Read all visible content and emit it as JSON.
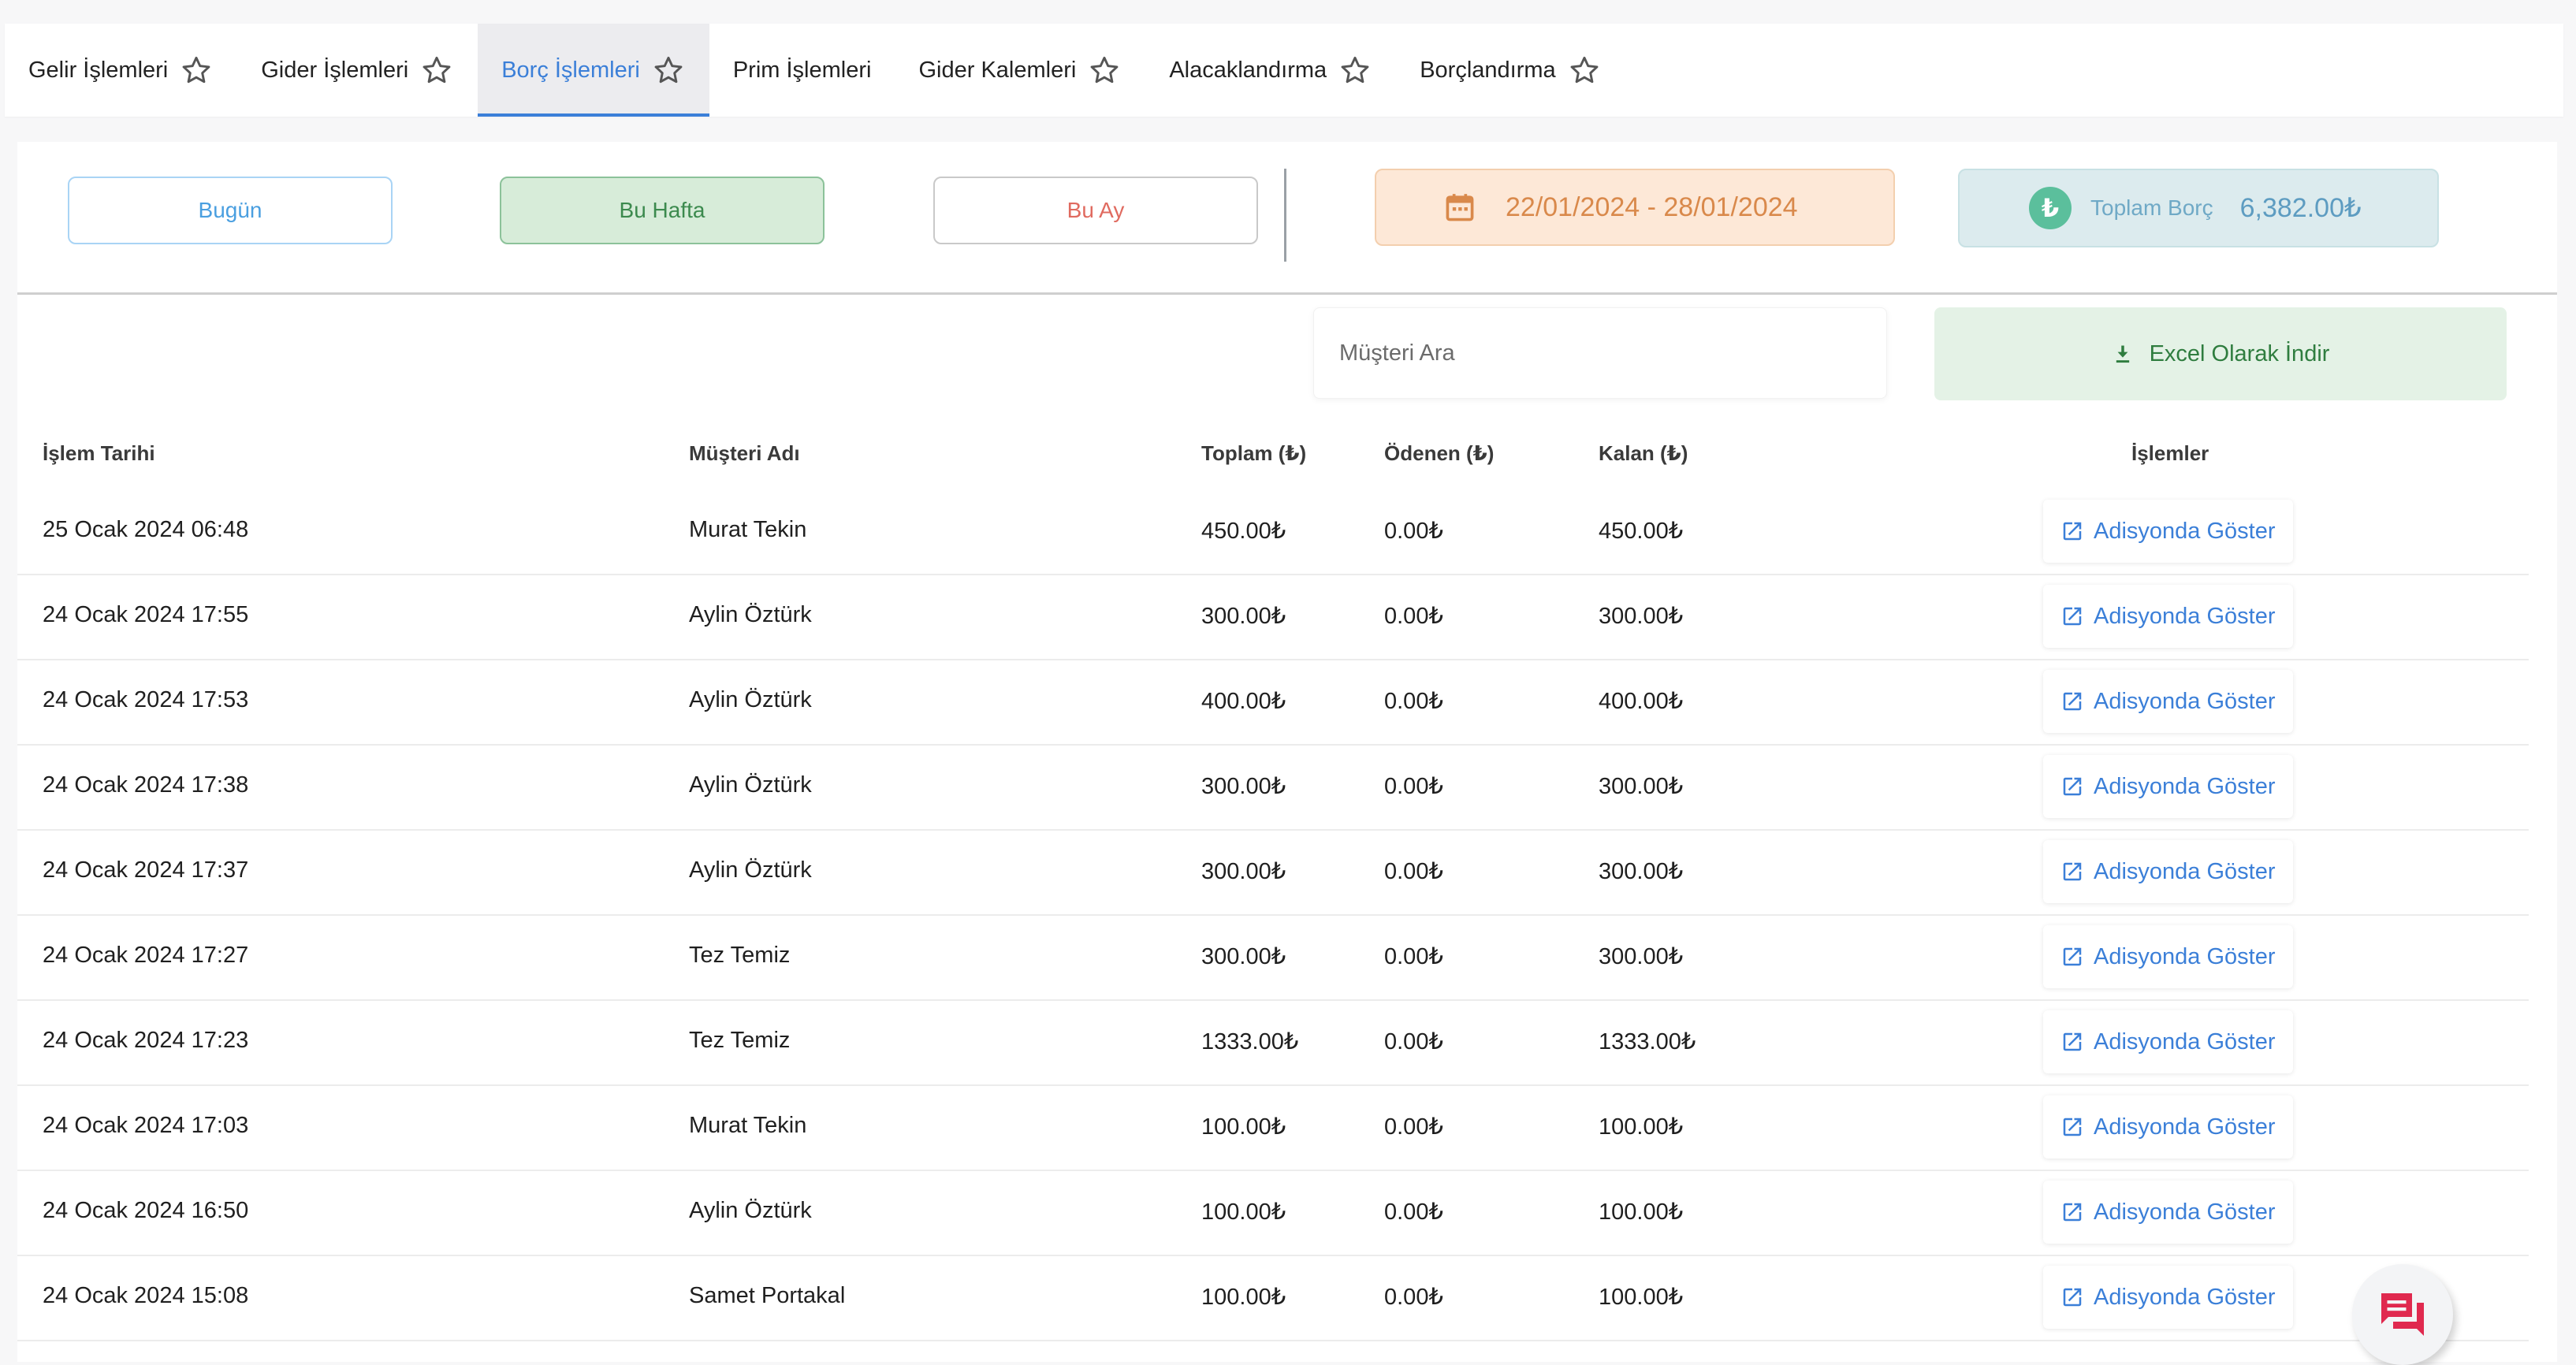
{
  "tabs": [
    {
      "label": "Gelir İşlemleri",
      "starred": true,
      "active": false
    },
    {
      "label": "Gider İşlemleri",
      "starred": true,
      "active": false
    },
    {
      "label": "Borç İşlemleri",
      "starred": true,
      "active": true
    },
    {
      "label": "Prim İşlemleri",
      "starred": false,
      "active": false
    },
    {
      "label": "Gider Kalemleri",
      "starred": true,
      "active": false
    },
    {
      "label": "Alacaklandırma",
      "starred": true,
      "active": false
    },
    {
      "label": "Borçlandırma",
      "starred": true,
      "active": false
    }
  ],
  "filters": {
    "today": "Bugün",
    "week": "Bu Hafta",
    "month": "Bu Ay"
  },
  "date_range": "22/01/2024 - 28/01/2024",
  "total": {
    "label": "Toplam Borç",
    "value": "6,382.00₺"
  },
  "search": {
    "placeholder": "Müşteri Ara",
    "value": ""
  },
  "excel_label": "Excel Olarak İndir",
  "table": {
    "headers": {
      "date": "İşlem Tarihi",
      "customer": "Müşteri Adı",
      "total": "Toplam (₺)",
      "paid": "Ödenen (₺)",
      "remaining": "Kalan (₺)",
      "actions": "İşlemler"
    },
    "action_label": "Adisyonda Göster",
    "rows": [
      {
        "date": "25 Ocak 2024 06:48",
        "customer": "Murat Tekin",
        "total": "450.00₺",
        "paid": "0.00₺",
        "remaining": "450.00₺"
      },
      {
        "date": "24 Ocak 2024 17:55",
        "customer": "Aylin Öztürk",
        "total": "300.00₺",
        "paid": "0.00₺",
        "remaining": "300.00₺"
      },
      {
        "date": "24 Ocak 2024 17:53",
        "customer": "Aylin Öztürk",
        "total": "400.00₺",
        "paid": "0.00₺",
        "remaining": "400.00₺"
      },
      {
        "date": "24 Ocak 2024 17:38",
        "customer": "Aylin Öztürk",
        "total": "300.00₺",
        "paid": "0.00₺",
        "remaining": "300.00₺"
      },
      {
        "date": "24 Ocak 2024 17:37",
        "customer": "Aylin Öztürk",
        "total": "300.00₺",
        "paid": "0.00₺",
        "remaining": "300.00₺"
      },
      {
        "date": "24 Ocak 2024 17:27",
        "customer": "Tez Temiz",
        "total": "300.00₺",
        "paid": "0.00₺",
        "remaining": "300.00₺"
      },
      {
        "date": "24 Ocak 2024 17:23",
        "customer": "Tez Temiz",
        "total": "1333.00₺",
        "paid": "0.00₺",
        "remaining": "1333.00₺"
      },
      {
        "date": "24 Ocak 2024 17:03",
        "customer": "Murat Tekin",
        "total": "100.00₺",
        "paid": "0.00₺",
        "remaining": "100.00₺"
      },
      {
        "date": "24 Ocak 2024 16:50",
        "customer": "Aylin Öztürk",
        "total": "100.00₺",
        "paid": "0.00₺",
        "remaining": "100.00₺"
      },
      {
        "date": "24 Ocak 2024 15:08",
        "customer": "Samet Portakal",
        "total": "100.00₺",
        "paid": "0.00₺",
        "remaining": "100.00₺"
      }
    ]
  },
  "icons": {
    "tab_star": "star-outline-icon",
    "date": "calendar-icon",
    "currency": "lira-icon",
    "excel": "download-icon",
    "row_action": "open-in-new-icon",
    "chat": "chat-icon"
  },
  "colors": {
    "accent": "#3b7fd8",
    "chat": "#e0294f",
    "success": "#3c8a4e",
    "warning": "#d9894b"
  }
}
